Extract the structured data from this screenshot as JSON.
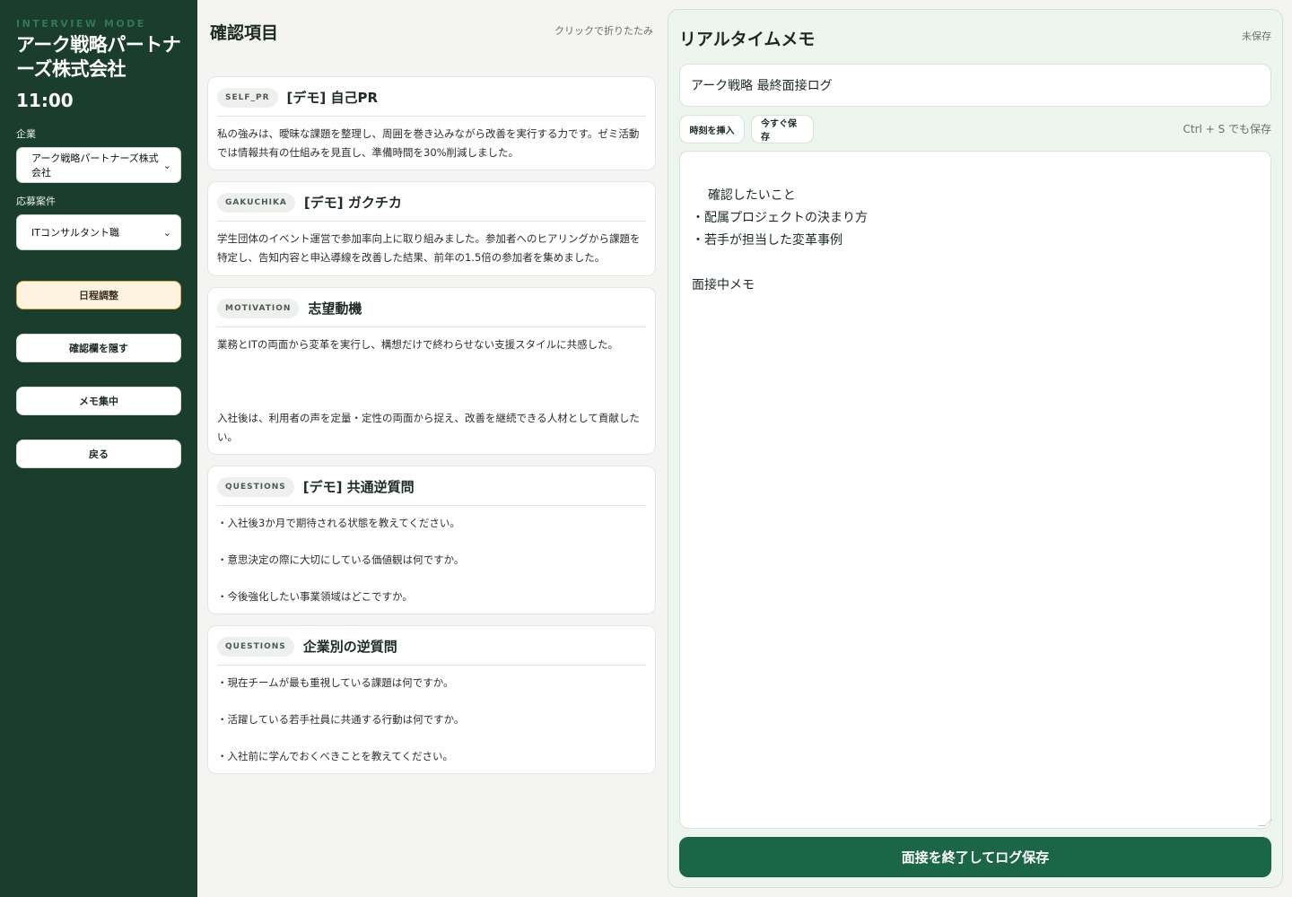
{
  "sidebar": {
    "mode_label": "INTERVIEW MODE",
    "company_title": "アーク戦略パートナーズ株式会社",
    "time": "11:00",
    "company_label": "企業",
    "company_value": "アーク戦略パートナーズ株式会社",
    "position_label": "応募案件",
    "position_value": "ITコンサルタント職",
    "schedule_button": "日程調整",
    "hide_button": "確認欄を隠す",
    "focus_button": "メモ集中",
    "back_button": "戻る"
  },
  "checklist": {
    "title": "確認項目",
    "hint": "クリックで折りたたみ",
    "cards": [
      {
        "tag": "SELF_PR",
        "title": "[デモ] 自己PR",
        "body": "私の強みは、曖昧な課題を整理し、周囲を巻き込みながら改善を実行する力です。ゼミ活動では情報共有の仕組みを見直し、準備時間を30%削減しました。"
      },
      {
        "tag": "GAKUCHIKA",
        "title": "[デモ] ガクチカ",
        "body": "学生団体のイベント運営で参加率向上に取り組みました。参加者へのヒアリングから課題を特定し、告知内容と申込導線を改善した結果、前年の1.5倍の参加者を集めました。"
      },
      {
        "tag": "MOTIVATION",
        "title": "志望動機",
        "body": "業務とITの両面から変革を実行し、構想だけで終わらせない支援スタイルに共感した。\n\n\n\n入社後は、利用者の声を定量・定性の両面から捉え、改善を継続できる人材として貢献したい。"
      },
      {
        "tag": "QUESTIONS",
        "title": "[デモ] 共通逆質問",
        "body": "・入社後3か月で期待される状態を教えてください。\n\n・意思決定の際に大切にしている価値観は何ですか。\n\n・今後強化したい事業領域はどこですか。"
      },
      {
        "tag": "QUESTIONS",
        "title": "企業別の逆質問",
        "body": "・現在チームが最も重視している課題は何ですか。\n\n・活躍している若手社員に共通する行動は何ですか。\n\n・入社前に学んでおくべきことを教えてください。"
      }
    ]
  },
  "memo": {
    "title": "リアルタイムメモ",
    "status": "未保存",
    "log_title": "アーク戦略 最終面接ログ",
    "insert_time_button": "時刻を挿入",
    "save_now_button": "今すぐ保存",
    "shortcut_hint": "Ctrl + S でも保存",
    "content": "確認したいこと\n・配属プロジェクトの決まり方\n・若手が担当した変革事例\n\n面接中メモ",
    "end_button": "面接を終了してログ保存"
  }
}
